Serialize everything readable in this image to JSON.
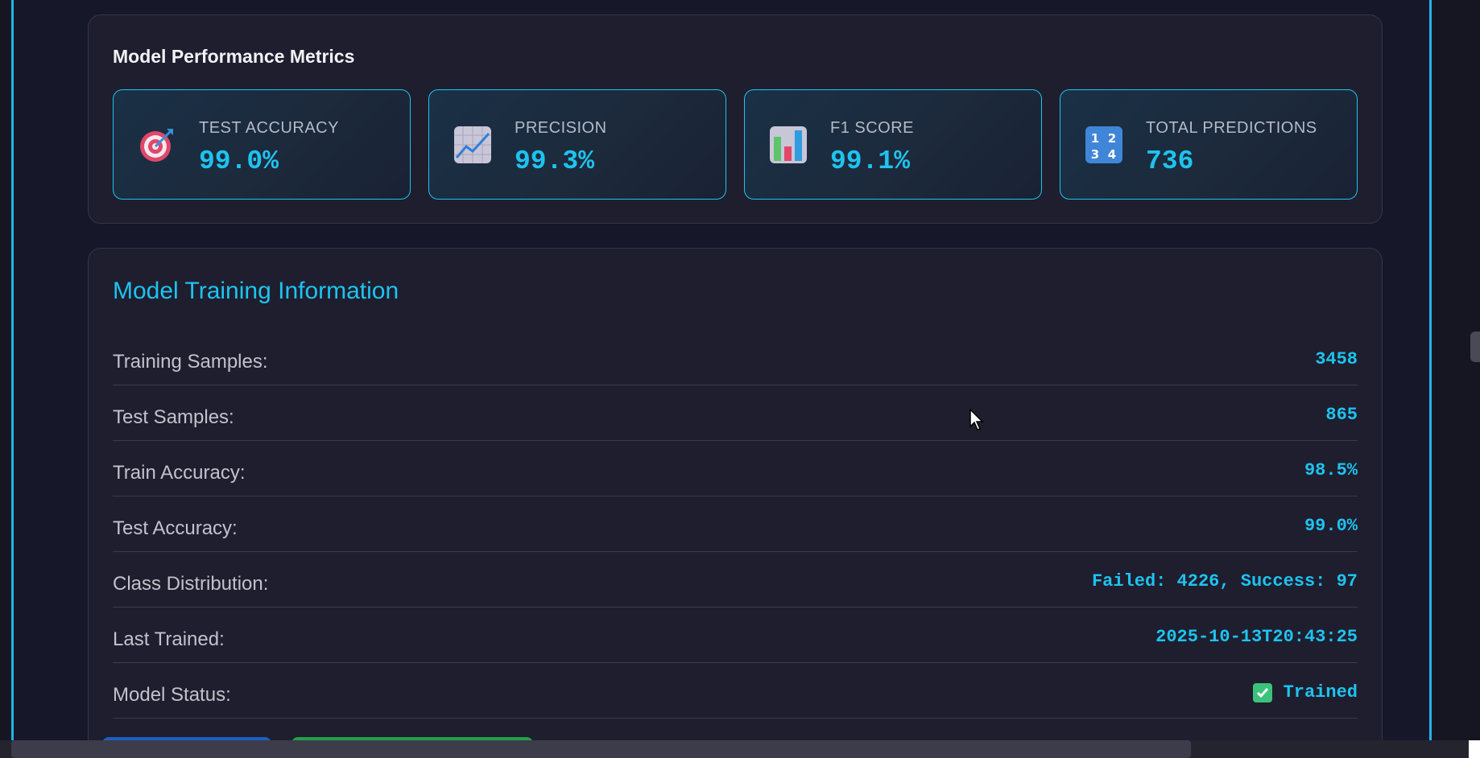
{
  "metrics_card": {
    "title": "Model Performance Metrics",
    "metrics": [
      {
        "label": "TEST ACCURACY",
        "value": "99.0%",
        "icon": "target-icon"
      },
      {
        "label": "PRECISION",
        "value": "99.3%",
        "icon": "chart-increasing-icon"
      },
      {
        "label": "F1 SCORE",
        "value": "99.1%",
        "icon": "bar-chart-icon"
      },
      {
        "label": "TOTAL PREDICTIONS",
        "value": "736",
        "icon": "numbers-icon"
      }
    ]
  },
  "info_card": {
    "title": "Model Training Information",
    "rows": [
      {
        "key": "Training Samples:",
        "value": "3458"
      },
      {
        "key": "Test Samples:",
        "value": "865"
      },
      {
        "key": "Train Accuracy:",
        "value": "98.5%"
      },
      {
        "key": "Test Accuracy:",
        "value": "99.0%"
      },
      {
        "key": "Class Distribution:",
        "value": "Failed: 4226, Success: 97"
      },
      {
        "key": "Last Trained:",
        "value": "2025-10-13T20:43:25"
      },
      {
        "key": "Model Status:",
        "value": "Trained",
        "icon": "check-mark-icon"
      }
    ]
  },
  "colors": {
    "accent": "#1ec3ef",
    "background": "#17172a",
    "card": "#1e1e2f",
    "success": "#3cc27a",
    "button_blue": "#1e5fbf",
    "button_green": "#22a046"
  }
}
